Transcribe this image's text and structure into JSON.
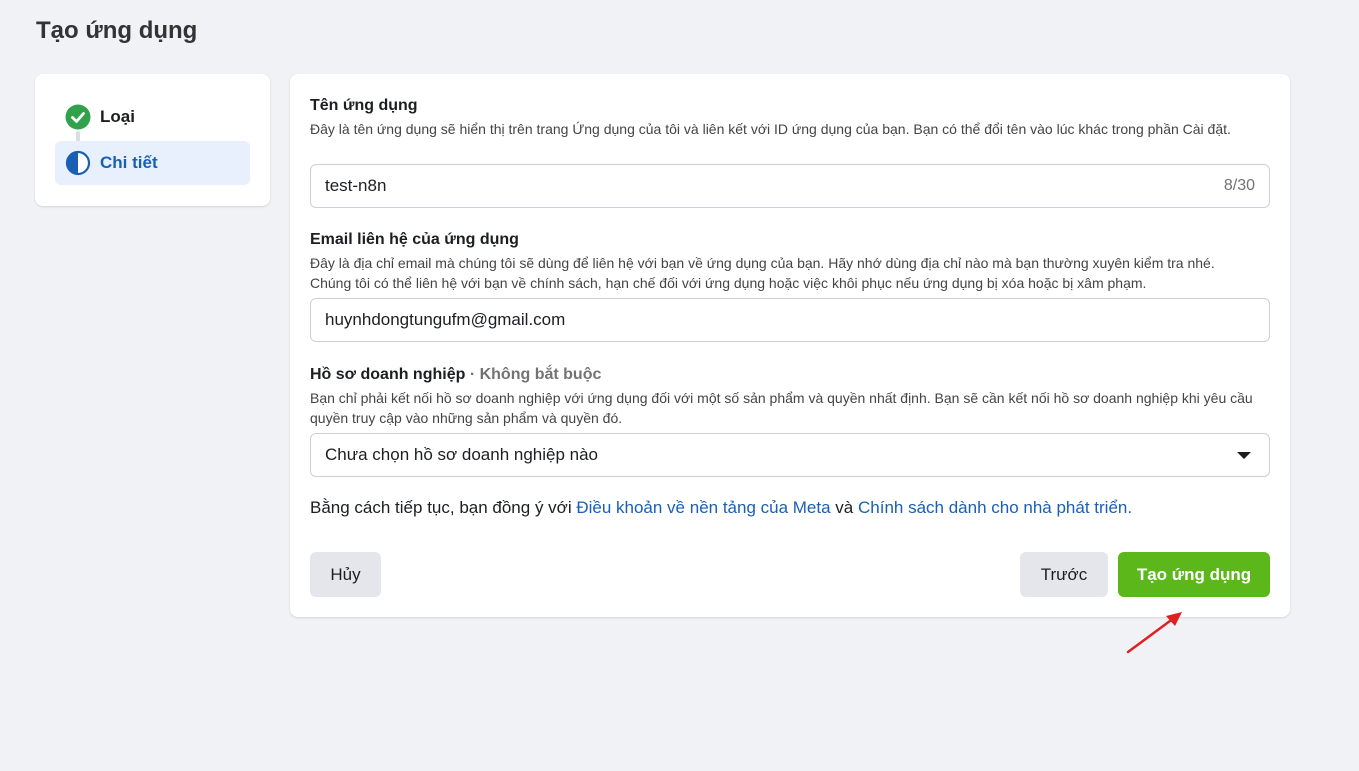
{
  "page": {
    "title": "Tạo ứng dụng"
  },
  "steps": [
    {
      "label": "Loại",
      "state": "complete",
      "icon": "check-circle-icon"
    },
    {
      "label": "Chi tiết",
      "state": "current",
      "icon": "half-circle-icon"
    }
  ],
  "app_name": {
    "title": "Tên ứng dụng",
    "description": "Đây là tên ứng dụng sẽ hiển thị trên trang Ứng dụng của tôi và liên kết với ID ứng dụng của bạn. Bạn có thể đổi tên vào lúc khác trong phần Cài đặt.",
    "value": "test-n8n",
    "counter": "8/30"
  },
  "email": {
    "title": "Email liên hệ của ứng dụng",
    "description_line1": "Đây là địa chỉ email mà chúng tôi sẽ dùng để liên hệ với bạn về ứng dụng của bạn. Hãy nhớ dùng địa chỉ nào mà bạn thường xuyên kiểm tra nhé.",
    "description_line2": "Chúng tôi có thể liên hệ với bạn về chính sách, hạn chế đối với ứng dụng hoặc việc khôi phục nếu ứng dụng bị xóa hoặc bị xâm phạm.",
    "value": "huynhdongtungufm@gmail.com"
  },
  "business": {
    "title": "Hồ sơ doanh nghiệp",
    "optional": "· Không bắt buộc",
    "description": "Bạn chỉ phải kết nối hồ sơ doanh nghiệp với ứng dụng đối với một số sản phẩm và quyền nhất định. Bạn sẽ cần kết nối hồ sơ doanh nghiệp khi yêu cầu quyền truy cập vào những sản phẩm và quyền đó.",
    "selected": "Chưa chọn hồ sơ doanh nghiệp nào"
  },
  "terms": {
    "prefix": "Bằng cách tiếp tục, bạn đồng ý với",
    "link1": "Điều khoản về nền tảng của Meta",
    "middle": "và",
    "link2": "Chính sách dành cho nhà phát triển."
  },
  "buttons": {
    "cancel": "Hủy",
    "previous": "Trước",
    "create": "Tạo ứng dụng"
  },
  "colors": {
    "accent_blue": "#1a5fb4",
    "create_green": "#5cb81a",
    "check_green": "#31a24c",
    "annotation_red": "#e02020"
  }
}
